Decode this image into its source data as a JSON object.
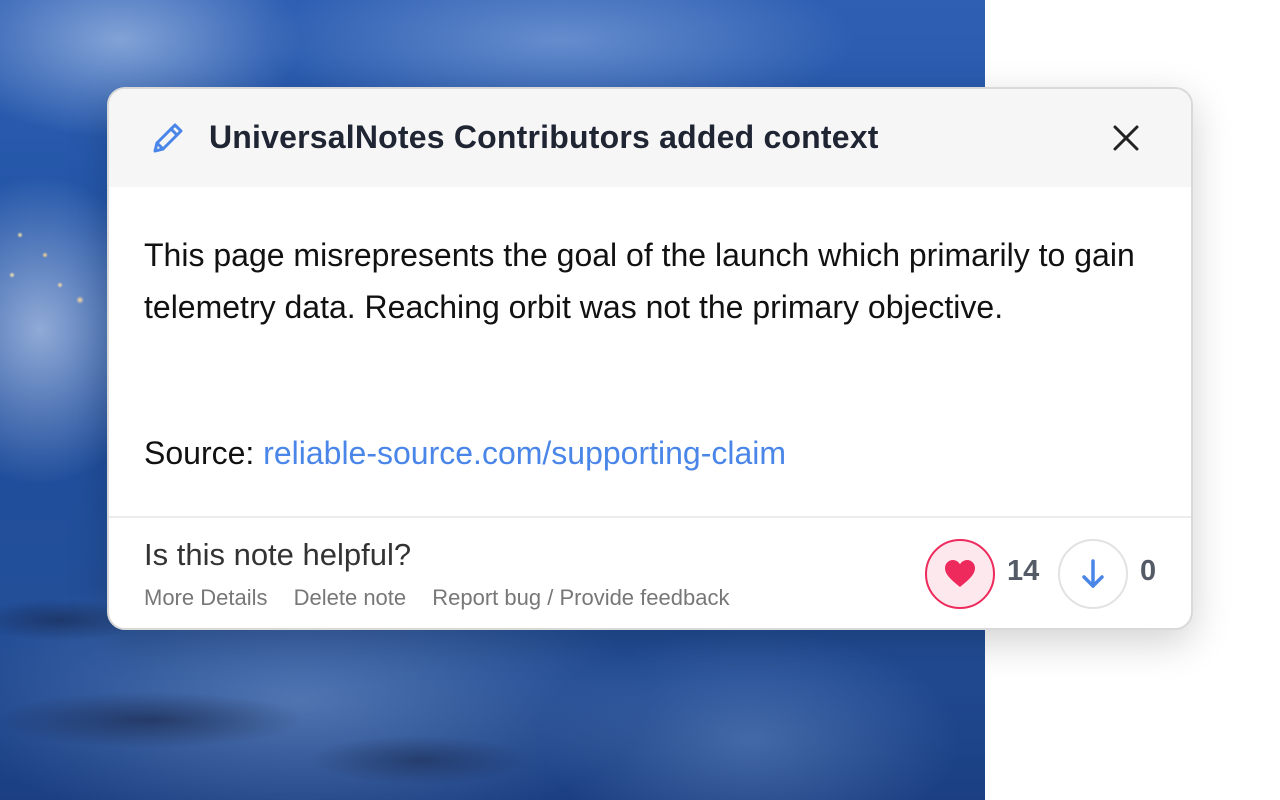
{
  "note": {
    "title": "UniversalNotes Contributors added context",
    "body": "This page misrepresents the goal of the launch which primarily to gain telemetry data. Reaching orbit was not the primary objective.",
    "source_label": "Source:",
    "source_link": "reliable-source.com/supporting-claim"
  },
  "footer": {
    "question": "Is this note helpful?",
    "links": [
      "More Details",
      "Delete note",
      "Report bug / Provide feedback"
    ]
  },
  "rating": {
    "like_count": "14",
    "dislike_count": "0"
  },
  "icons": {
    "header": "pencil-icon",
    "close": "close-icon",
    "like": "heart-icon",
    "dislike": "arrow-down-icon"
  },
  "colors": {
    "accent_blue": "#4a86e8",
    "like_red": "#ee2a5c",
    "header_bg": "#f6f6f7"
  }
}
